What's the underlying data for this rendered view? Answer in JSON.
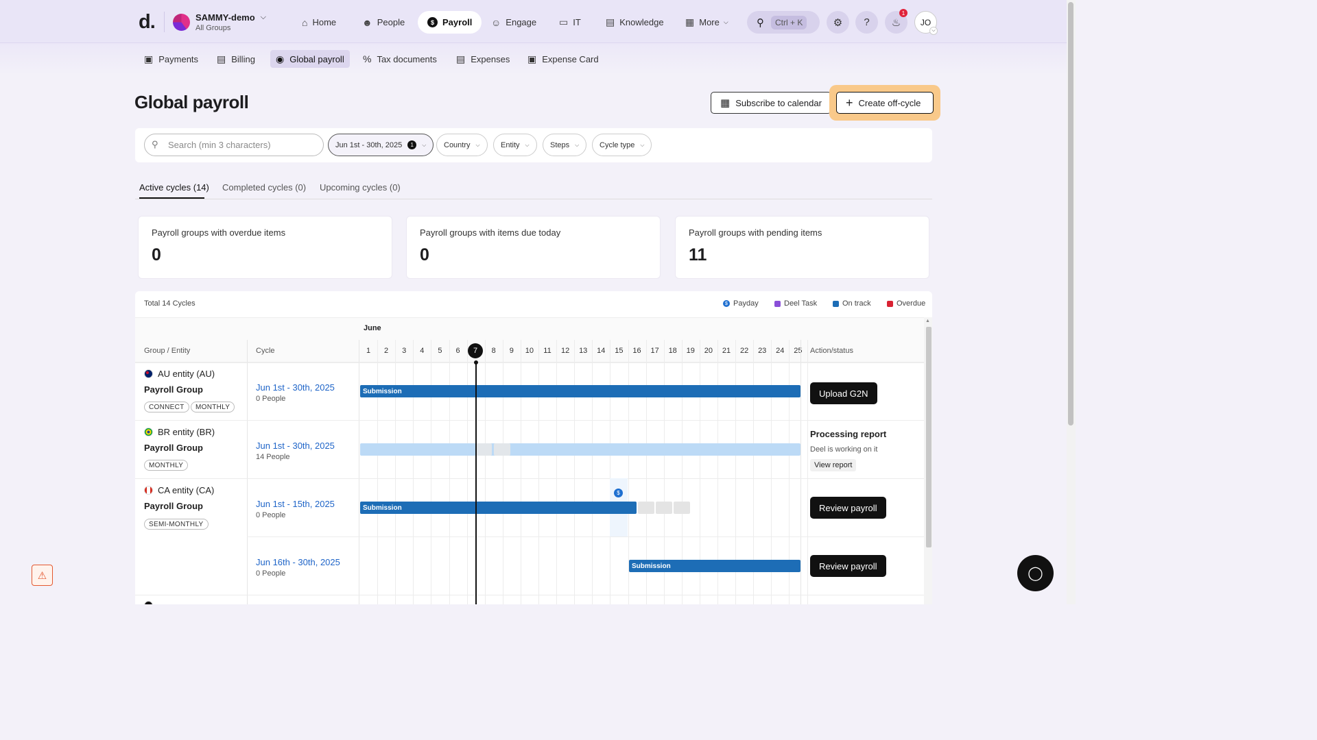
{
  "brand": {
    "logo": "d."
  },
  "org": {
    "name": "SAMMY-demo",
    "sub": "All Groups"
  },
  "nav": {
    "home": "Home",
    "people": "People",
    "payroll": "Payroll",
    "engage": "Engage",
    "it": "IT",
    "knowledge": "Knowledge",
    "more": "More"
  },
  "search_shortcut": "Ctrl + K",
  "notifications_count": "1",
  "user_initials": "JO",
  "subnav": {
    "payments": "Payments",
    "billing": "Billing",
    "global_payroll": "Global payroll",
    "tax_documents": "Tax documents",
    "expenses": "Expenses",
    "expense_card": "Expense Card"
  },
  "page": {
    "title": "Global payroll",
    "subscribe": "Subscribe to calendar",
    "create": "Create off-cycle"
  },
  "filters": {
    "search_placeholder": "Search (min 3 characters)",
    "date_range": "Jun 1st - 30th, 2025",
    "date_count": "1",
    "country": "Country",
    "entity": "Entity",
    "steps": "Steps",
    "cycle_type": "Cycle type"
  },
  "tabs": {
    "active": "Active cycles (14)",
    "completed": "Completed cycles (0)",
    "upcoming": "Upcoming cycles (0)"
  },
  "cards": [
    {
      "label": "Payroll groups with overdue items",
      "value": "0"
    },
    {
      "label": "Payroll groups with items due today",
      "value": "0"
    },
    {
      "label": "Payroll groups with pending items",
      "value": "11"
    }
  ],
  "table": {
    "total": "Total 14 Cycles",
    "legend": {
      "payday": "Payday",
      "deel_task": "Deel Task",
      "on_track": "On track",
      "overdue": "Overdue"
    },
    "colors": {
      "payday": "#1e6fd0",
      "deel_task": "#8a4fd8",
      "on_track": "#1d6db6",
      "overdue": "#d92232"
    },
    "month": "June",
    "headers": {
      "group": "Group / Entity",
      "cycle": "Cycle",
      "action": "Action/status"
    },
    "days": [
      "1",
      "2",
      "3",
      "4",
      "5",
      "6",
      "7",
      "8",
      "9",
      "10",
      "11",
      "12",
      "13",
      "14",
      "15",
      "16",
      "17",
      "18",
      "19",
      "20",
      "21",
      "22",
      "23",
      "24",
      "25"
    ],
    "today": "7",
    "payday_symbol": "$",
    "rows": {
      "au": {
        "entity": "AU entity (AU)",
        "group": "Payroll Group",
        "tags": [
          "CONNECT",
          "MONTHLY"
        ],
        "cycle": "Jun 1st - 30th, 2025",
        "people": "0 People",
        "bar": "Submission",
        "action": "Upload G2N"
      },
      "br": {
        "entity": "BR entity (BR)",
        "group": "Payroll Group",
        "tags": [
          "MONTHLY"
        ],
        "cycle": "Jun 1st - 30th, 2025",
        "people": "14 People",
        "status_title": "Processing report",
        "status_sub": "Deel is working on it",
        "status_btn": "View report"
      },
      "ca": {
        "entity": "CA entity (CA)",
        "group": "Payroll Group",
        "tags": [
          "SEMI-MONTHLY"
        ],
        "cycle": "Jun 1st - 15th, 2025",
        "people": "0 People",
        "bar": "Submission",
        "action": "Review payroll"
      },
      "ca2": {
        "cycle": "Jun 16th - 30th, 2025",
        "people": "0 People",
        "bar": "Submission",
        "action": "Review payroll"
      }
    }
  }
}
